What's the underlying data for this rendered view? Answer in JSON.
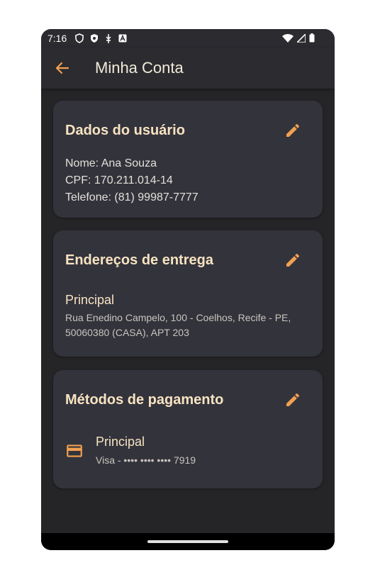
{
  "status_bar": {
    "time": "7:16",
    "left_icons": [
      "shield-outline-icon",
      "shield-icon",
      "usb-icon",
      "font-icon"
    ],
    "right_icons": [
      "wifi-icon",
      "signal-icon",
      "battery-icon"
    ]
  },
  "app_bar": {
    "title": "Minha Conta",
    "back_icon": "arrow-back-icon"
  },
  "colors": {
    "accent": "#f0a050",
    "title_text": "#f7e3c0",
    "background": "#252528",
    "card": "#33333c"
  },
  "user_card": {
    "title": "Dados do usuário",
    "name": "Nome: Ana Souza",
    "cpf": "CPF: 170.211.014-14",
    "phone": "Telefone: (81) 99987-7777"
  },
  "address_card": {
    "title": "Endereços de entrega",
    "label": "Principal",
    "line1": "Rua Enedino Campelo, 100 - Coelhos, Recife - PE,",
    "line2": "50060380 (CASA), APT 203"
  },
  "payment_card": {
    "title": "Métodos de pagamento",
    "label": "Principal",
    "detail": "Visa - •••• •••• •••• 7919",
    "icon": "credit-card-icon"
  }
}
